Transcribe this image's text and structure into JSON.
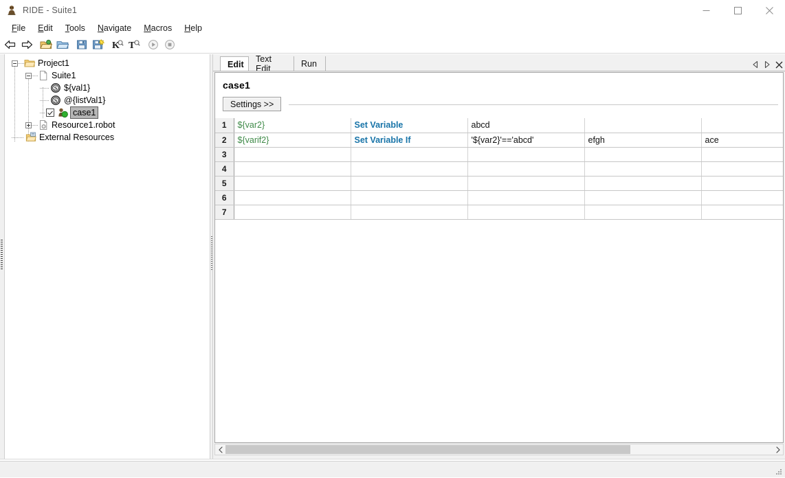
{
  "window": {
    "title": "RIDE - Suite1",
    "app_icon": "robot-icon",
    "controls": {
      "minimize": "minimize-icon",
      "maximize": "maximize-icon",
      "close": "close-icon"
    }
  },
  "menubar": {
    "items": [
      {
        "accel": "F",
        "rest": "ile"
      },
      {
        "accel": "E",
        "rest": "dit"
      },
      {
        "accel": "T",
        "rest": "ools"
      },
      {
        "accel": "N",
        "rest": "avigate"
      },
      {
        "accel": "M",
        "rest": "acros"
      },
      {
        "accel": "H",
        "rest": "elp"
      }
    ]
  },
  "toolbar": {
    "buttons": [
      {
        "name": "back-arrow-icon"
      },
      {
        "name": "forward-arrow-icon"
      },
      {
        "name": "open-project-icon"
      },
      {
        "name": "open-folder-icon"
      },
      {
        "name": "save-icon"
      },
      {
        "name": "save-all-icon"
      },
      {
        "name": "search-keyword-icon"
      },
      {
        "name": "search-text-icon"
      },
      {
        "name": "run-icon"
      },
      {
        "name": "stop-icon"
      }
    ]
  },
  "tree": {
    "nodes": [
      {
        "label": "Project1",
        "icon": "folder-icon",
        "depth": 0,
        "expander": "minus",
        "checkbox": false,
        "selected": false
      },
      {
        "label": "Suite1",
        "icon": "file-icon",
        "depth": 1,
        "expander": "minus",
        "checkbox": false,
        "selected": false
      },
      {
        "label": "${val1}",
        "icon": "variable-icon",
        "depth": 2,
        "expander": "none",
        "checkbox": false,
        "selected": false
      },
      {
        "label": "@{listVal1}",
        "icon": "variable-icon",
        "depth": 2,
        "expander": "none",
        "checkbox": false,
        "selected": false
      },
      {
        "label": "case1",
        "icon": "testcase-icon",
        "depth": 2,
        "expander": "none",
        "checkbox": true,
        "selected": true
      },
      {
        "label": "Resource1.robot",
        "icon": "resource-icon",
        "depth": 1,
        "expander": "plus",
        "checkbox": false,
        "selected": false
      },
      {
        "label": "External Resources",
        "icon": "ext-res-icon",
        "depth": 0,
        "expander": "none",
        "checkbox": false,
        "selected": false
      }
    ]
  },
  "notebook": {
    "tabs": [
      {
        "label": "Edit",
        "active": true
      },
      {
        "label": "Text Edit",
        "active": false
      },
      {
        "label": "Run",
        "active": false
      }
    ],
    "nav": {
      "prev": "prev-tab-icon",
      "next": "next-tab-icon",
      "close": "close-tab-icon"
    }
  },
  "editor": {
    "case_name": "case1",
    "settings_button": "Settings >>"
  },
  "grid": {
    "rows": [
      {
        "num": "1",
        "cells": [
          {
            "text": "${var2}",
            "style": "var"
          },
          {
            "text": "Set Variable",
            "style": "kw"
          },
          {
            "text": "abcd",
            "style": "plain"
          },
          {
            "text": "",
            "style": "dim"
          },
          {
            "text": "",
            "style": "dim"
          }
        ]
      },
      {
        "num": "2",
        "cells": [
          {
            "text": "${varif2}",
            "style": "var"
          },
          {
            "text": "Set Variable If",
            "style": "kw"
          },
          {
            "text": "'${var2}'=='abcd'",
            "style": "plain"
          },
          {
            "text": "efgh",
            "style": "plain"
          },
          {
            "text": "ace",
            "style": "plain"
          }
        ]
      },
      {
        "num": "3",
        "cells": [
          {
            "text": "",
            "style": "plain"
          },
          {
            "text": "",
            "style": "plain"
          },
          {
            "text": "",
            "style": "plain"
          },
          {
            "text": "",
            "style": "plain"
          },
          {
            "text": "",
            "style": "plain"
          }
        ]
      },
      {
        "num": "4",
        "cells": [
          {
            "text": "",
            "style": "plain"
          },
          {
            "text": "",
            "style": "plain"
          },
          {
            "text": "",
            "style": "plain"
          },
          {
            "text": "",
            "style": "plain"
          },
          {
            "text": "",
            "style": "plain"
          }
        ]
      },
      {
        "num": "5",
        "cells": [
          {
            "text": "",
            "style": "plain"
          },
          {
            "text": "",
            "style": "plain"
          },
          {
            "text": "",
            "style": "plain"
          },
          {
            "text": "",
            "style": "plain"
          },
          {
            "text": "",
            "style": "plain"
          }
        ]
      },
      {
        "num": "6",
        "cells": [
          {
            "text": "",
            "style": "plain"
          },
          {
            "text": "",
            "style": "plain"
          },
          {
            "text": "",
            "style": "plain"
          },
          {
            "text": "",
            "style": "plain"
          },
          {
            "text": "",
            "style": "plain"
          }
        ]
      },
      {
        "num": "7",
        "cells": [
          {
            "text": "",
            "style": "plain"
          },
          {
            "text": "",
            "style": "plain"
          },
          {
            "text": "",
            "style": "plain"
          },
          {
            "text": "",
            "style": "plain"
          },
          {
            "text": "",
            "style": "plain"
          }
        ]
      }
    ]
  },
  "scrollbar": {
    "left_arrow": "scroll-left-icon",
    "right_arrow": "scroll-right-icon",
    "thumb_fraction_percent": 74
  },
  "colors": {
    "variable_green": "#3f8a48",
    "keyword_blue": "#1874a8",
    "selection_grey": "#b6b6b6",
    "panel_grey": "#f0f0f0"
  }
}
